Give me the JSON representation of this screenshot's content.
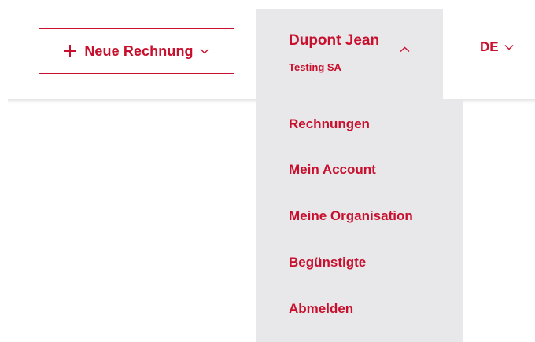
{
  "header": {
    "new_invoice": {
      "label": "Neue Rechnung",
      "plus_icon": "plus-icon",
      "chevron_icon": "chevron-down-icon"
    },
    "user": {
      "name": "Dupont Jean",
      "organization": "Testing SA",
      "chevron_icon": "chevron-up-icon",
      "expanded": true
    },
    "language": {
      "label": "DE",
      "chevron_icon": "chevron-down-icon"
    }
  },
  "user_menu": {
    "items": [
      {
        "label": "Rechnungen"
      },
      {
        "label": "Mein Account"
      },
      {
        "label": "Meine Organisation"
      },
      {
        "label": "Begünstigte"
      },
      {
        "label": "Abmelden"
      }
    ]
  },
  "colors": {
    "accent": "#c8102e",
    "menu_background": "#e8e8ea",
    "background": "#ffffff"
  }
}
